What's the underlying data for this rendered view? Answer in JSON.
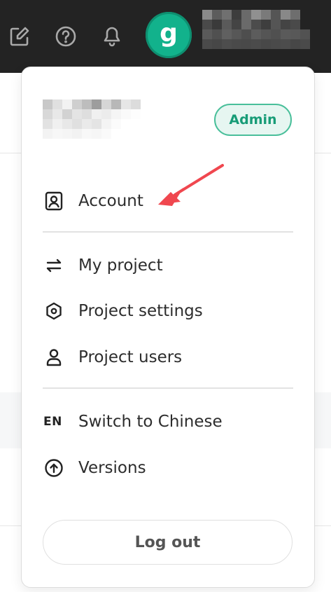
{
  "topbar": {
    "icons": [
      "edit-icon",
      "help-icon",
      "bell-icon"
    ],
    "avatar_letter": "g"
  },
  "menu": {
    "role_badge": "Admin",
    "items": [
      {
        "label": "Account",
        "icon": "account-icon"
      },
      {
        "label": "My project",
        "icon": "swap-icon"
      },
      {
        "label": "Project settings",
        "icon": "hexagon-icon"
      },
      {
        "label": "Project users",
        "icon": "user-icon"
      },
      {
        "label": "Switch to Chinese",
        "icon": "language-icon",
        "icon_text": "EN"
      },
      {
        "label": "Versions",
        "icon": "upgrade-icon"
      }
    ],
    "logout_label": "Log out"
  },
  "colors": {
    "topbar_bg": "#232323",
    "avatar": "#12b28c",
    "badge_text": "#179c77",
    "arrow": "#f0474f"
  }
}
